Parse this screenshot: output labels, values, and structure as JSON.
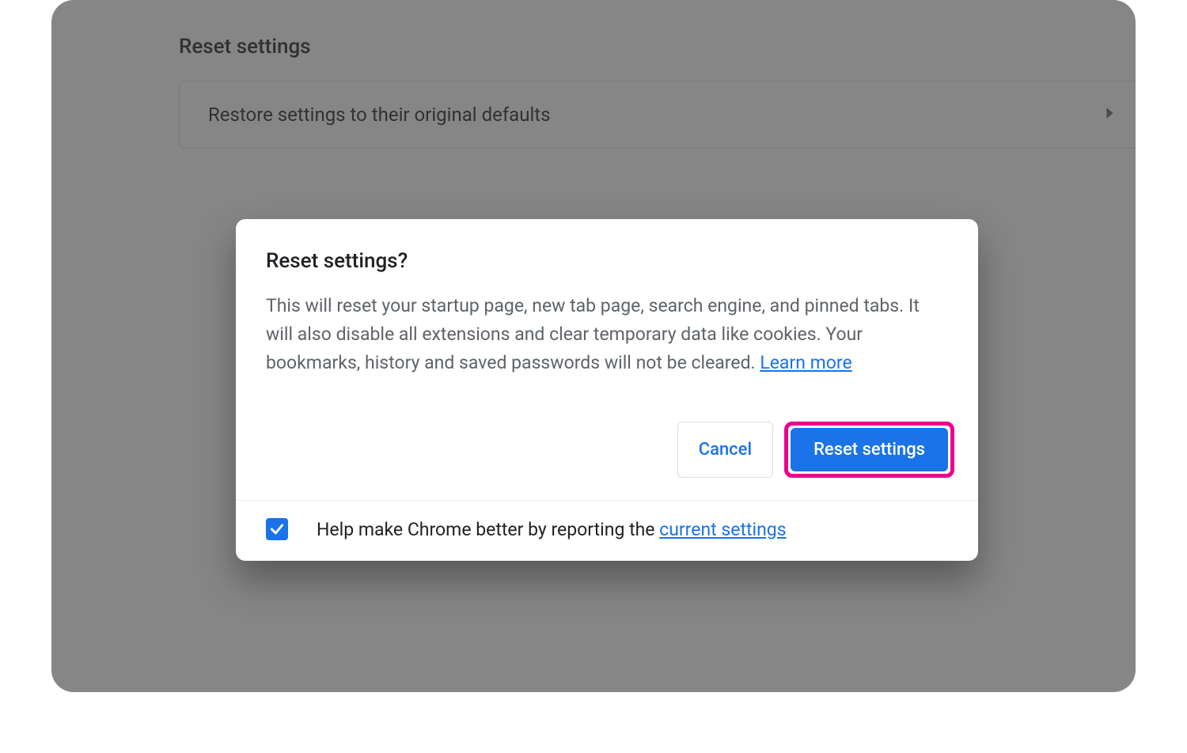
{
  "page": {
    "section_title": "Reset settings",
    "restore_option": "Restore settings to their original defaults"
  },
  "dialog": {
    "title": "Reset settings?",
    "body_text": "This will reset your startup page, new tab page, search engine, and pinned tabs. It will also disable all extensions and clear temporary data like cookies. Your bookmarks, history and saved passwords will not be cleared. ",
    "learn_more": "Learn more",
    "cancel": "Cancel",
    "confirm": "Reset settings",
    "footer_prefix": "Help make Chrome better by reporting the ",
    "footer_link": "current settings",
    "checkbox_checked": true
  },
  "colors": {
    "accent": "#1a73e8",
    "highlight": "#ec008c"
  }
}
